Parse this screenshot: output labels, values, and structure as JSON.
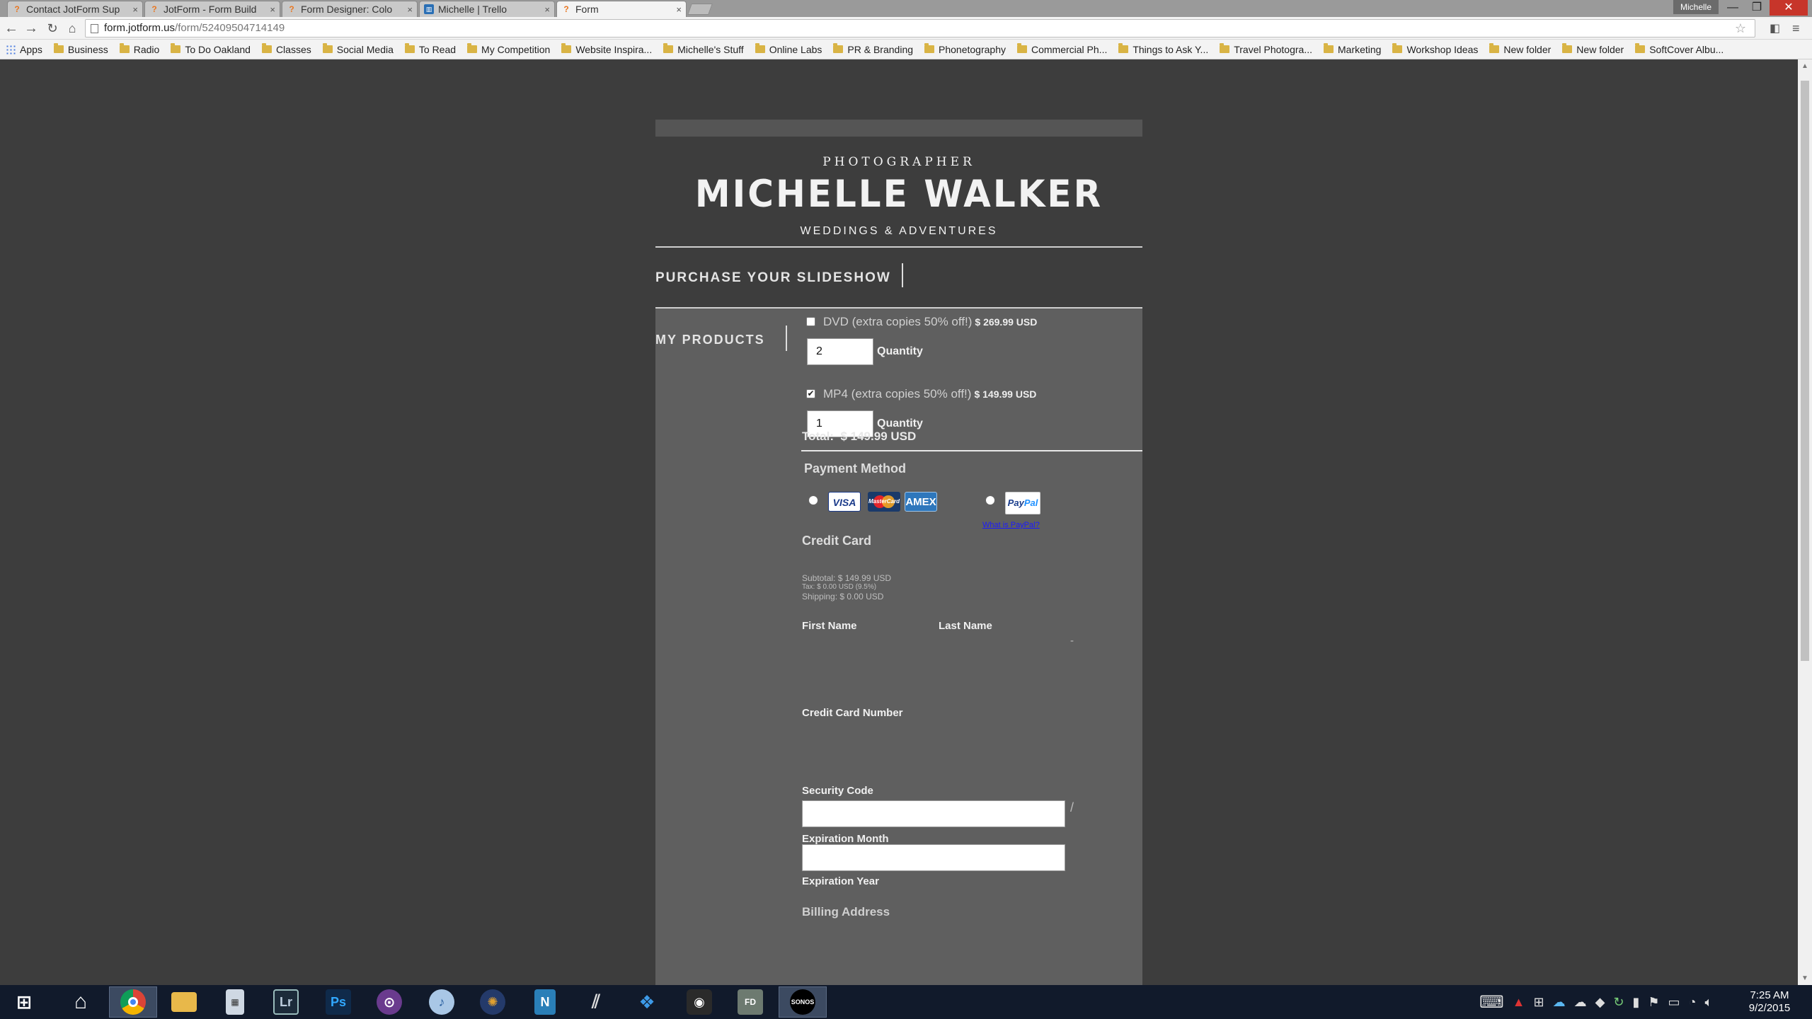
{
  "browser": {
    "tabs": [
      {
        "title": "Contact JotForm Sup",
        "favicon": "jotform-icon",
        "active": false
      },
      {
        "title": "JotForm - Form Build",
        "favicon": "jotform-icon",
        "active": false
      },
      {
        "title": "Form Designer: Colo",
        "favicon": "jotform-icon",
        "active": false
      },
      {
        "title": "Michelle | Trello",
        "favicon": "trello-icon",
        "active": false
      },
      {
        "title": "Form",
        "favicon": "jotform-icon",
        "active": true
      }
    ],
    "profile_name": "Michelle",
    "url_host": "form.jotform.us",
    "url_path": "/form/52409504714149",
    "bookmarks": [
      "Apps",
      "Business",
      "Radio",
      "To Do Oakland",
      "Classes",
      "Social Media",
      "To Read",
      "My Competition",
      "Website Inspira...",
      "Michelle's Stuff",
      "Online Labs",
      "PR & Branding",
      "Phonetography",
      "Commercial Ph...",
      "Things to Ask Y...",
      "Travel Photogra...",
      "Marketing",
      "Workshop Ideas",
      "New folder",
      "New folder",
      "SoftCover Albu..."
    ]
  },
  "logo": {
    "sup": "PHOTOGRAPHER",
    "main": "MICHELLE WALKER",
    "sub": "WEDDINGS & ADVENTURES"
  },
  "form": {
    "section_title": "PURCHASE YOUR SLIDESHOW",
    "products_label": "MY PRODUCTS",
    "products": [
      {
        "name": "DVD (extra copies 50% off!)",
        "price": "$ 269.99 USD",
        "checked": false,
        "quantity": "2",
        "quantity_label": "Quantity"
      },
      {
        "name": "MP4 (extra copies 50% off!)",
        "price": "$ 149.99 USD",
        "checked": true,
        "quantity": "1",
        "quantity_label": "Quantity"
      }
    ],
    "subtotal": "Subtotal:   $ 149.99 USD",
    "tax": "Tax:   $ 0.00 USD   (9.5%)",
    "shipping": "Shipping:   $ 0.00 USD",
    "total_label": "Total:",
    "total_value": "$ 149.99 USD",
    "payment_method_title": "Payment Method",
    "cards": [
      "VISA",
      "MasterCard",
      "AMEX"
    ],
    "paypal_label_a": "Pay",
    "paypal_label_b": "Pal",
    "what_is_paypal": "What is PayPal?",
    "credit_card_title": "Credit Card",
    "first_name_label": "First Name",
    "last_name_label": "Last Name",
    "dash": "-",
    "cc_number_label": "Credit Card Number",
    "security_code_label": "Security Code",
    "slash": "/",
    "exp_month_label": "Expiration Month",
    "exp_year_label": "Expiration Year",
    "billing_address_label": "Billing Address"
  },
  "taskbar": {
    "apps": [
      "start",
      "home",
      "chrome",
      "file-explorer",
      "calculator",
      "lightroom",
      "photoshop",
      "tor",
      "itunes",
      "camera-app",
      "word-like",
      "wunderlist",
      "dropbox",
      "webcam",
      "folder-fd",
      "sonos"
    ],
    "lightroom_label": "Lr",
    "photoshop_label": "Ps",
    "sonos_label": "SONOS",
    "clock_time": "7:25 AM",
    "clock_date": "9/2/2015"
  },
  "colors": {
    "page_bg": "#3d3d3d",
    "panel_bg": "#5f5f5f",
    "accent_close": "#c7352a",
    "taskbar_bg": "#111a2b"
  }
}
